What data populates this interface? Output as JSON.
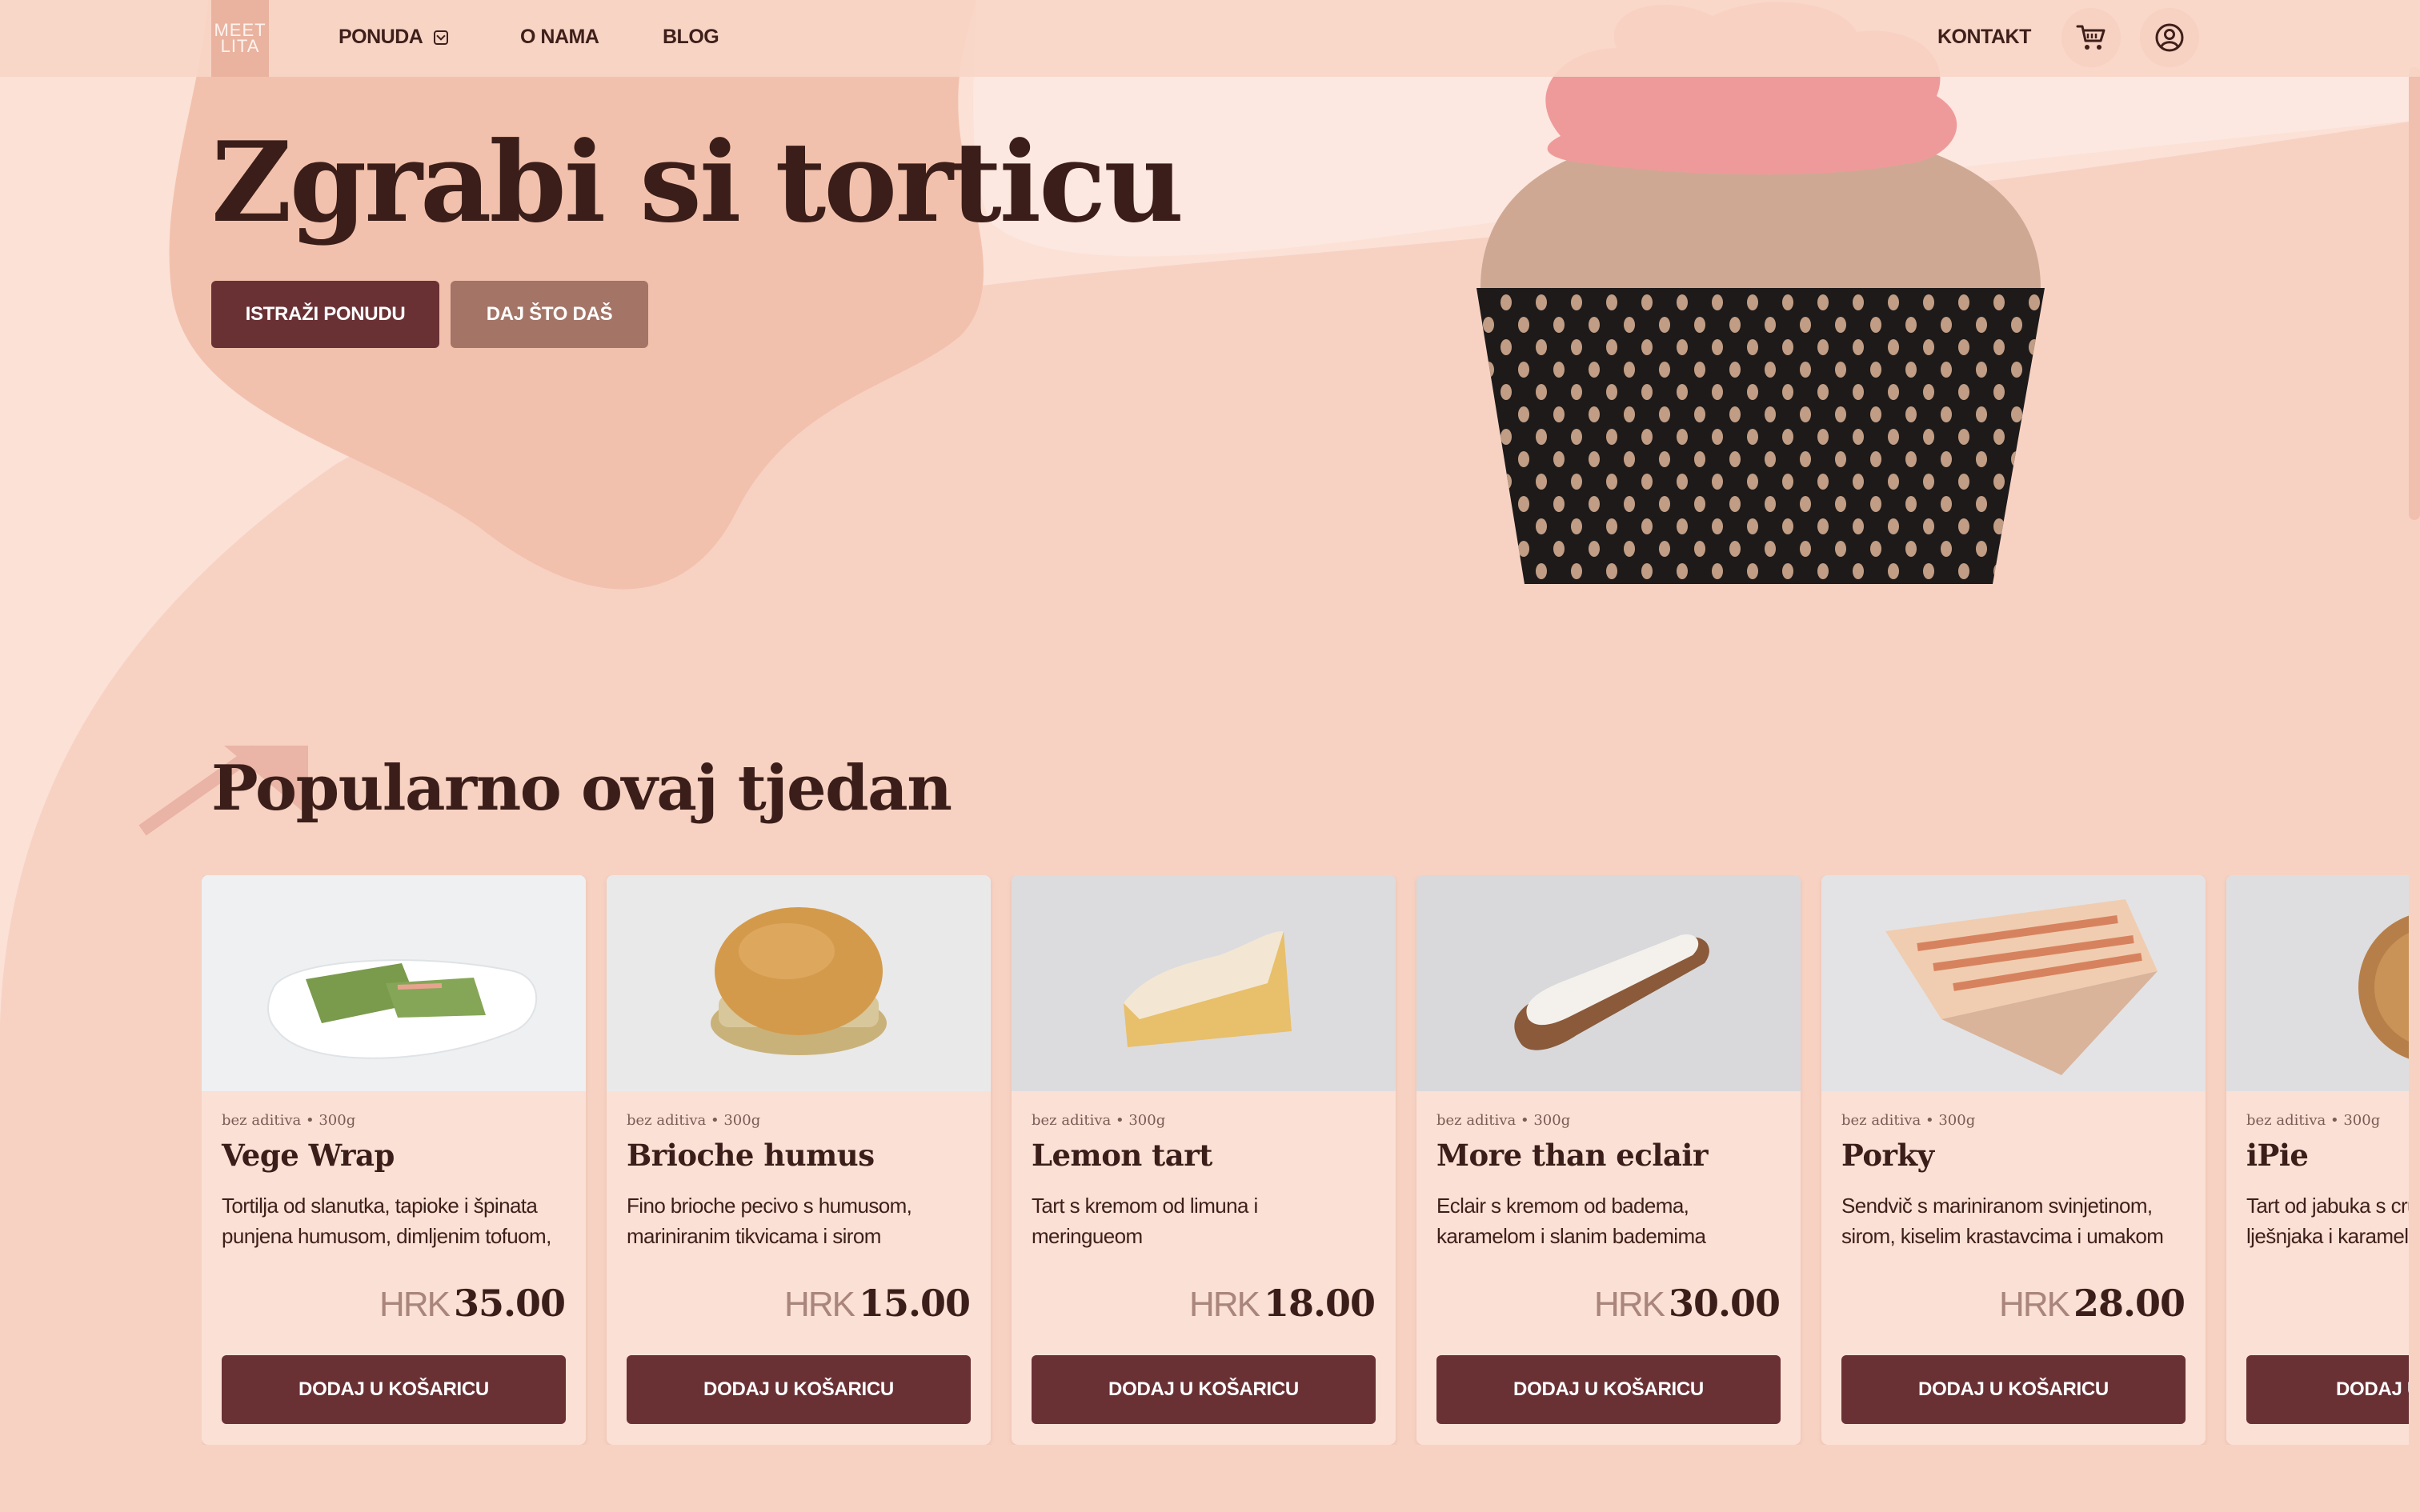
{
  "nav": {
    "logo_text": "MEET\nLITA",
    "links": [
      "PONUDA",
      "O NAMA",
      "BLOG"
    ],
    "contact": "KONTAKT",
    "cart_icon": "cart-icon",
    "user_icon": "user-circle-icon"
  },
  "hero": {
    "title": "Zgrabi si torticu",
    "primary_button": "ISTRAŽI PONUDU",
    "secondary_button": "DAJ ŠTO DAŠ"
  },
  "section": {
    "title": "Popularno ovaj tjedan"
  },
  "products": [
    {
      "meta": "bez aditiva • 300g",
      "name": "Vege Wrap",
      "desc": [
        "Tortilja od slanutka, tapioke i špinata",
        "punjena humusom, dimljenim tofuom,"
      ],
      "currency": "HRK",
      "price": "35.00",
      "button": "DODAJ U KOŠARICU"
    },
    {
      "meta": "bez aditiva • 300g",
      "name": "Brioche humus",
      "desc": [
        "Fino brioche pecivo s humusom,",
        "mariniranim tikvicama i sirom"
      ],
      "currency": "HRK",
      "price": "15.00",
      "button": "DODAJ U KOŠARICU"
    },
    {
      "meta": "bez aditiva • 300g",
      "name": "Lemon tart",
      "desc": [
        "Tart s kremom od limuna i",
        "meringueom"
      ],
      "currency": "HRK",
      "price": "18.00",
      "button": "DODAJ U KOŠARICU"
    },
    {
      "meta": "bez aditiva • 300g",
      "name": "More than eclair",
      "desc": [
        "Eclair s kremom od badema,",
        "karamelom i slanim bademima"
      ],
      "currency": "HRK",
      "price": "30.00",
      "button": "DODAJ U KOŠARICU"
    },
    {
      "meta": "bez aditiva • 300g",
      "name": "Porky",
      "desc": [
        "Sendvič s mariniranom svinjetinom,",
        "sirom, kiselim krastavcima i umakom"
      ],
      "currency": "HRK",
      "price": "28.00",
      "button": "DODAJ U KOŠARICU"
    },
    {
      "meta": "bez aditiva • 300g",
      "name": "iPie",
      "desc": [
        "Tart od jabuka s cru",
        "lješnjaka i karamelo"
      ],
      "currency": "",
      "price": "",
      "button": "DODAJ U"
    }
  ],
  "colors": {
    "background": "#fbe1d6",
    "accent": "#6a3135",
    "secondary": "#a47466",
    "text": "#3b1e19"
  }
}
